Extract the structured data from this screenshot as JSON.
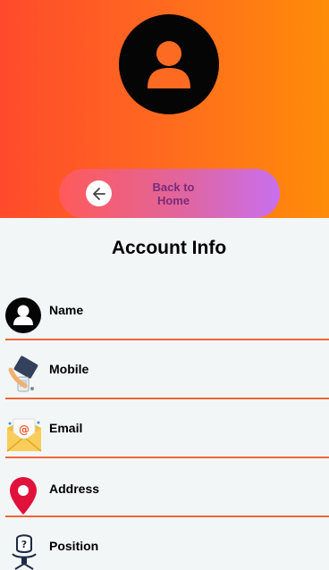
{
  "header": {
    "back_label": "Back to\nHome"
  },
  "page_title": "Account Info",
  "fields": [
    {
      "label": "Name",
      "icon": "user-icon"
    },
    {
      "label": "Mobile",
      "icon": "mobile-icon"
    },
    {
      "label": "Email",
      "icon": "email-icon"
    },
    {
      "label": "Address",
      "icon": "location-pin-icon"
    },
    {
      "label": "Position",
      "icon": "position-icon"
    }
  ],
  "colors": {
    "header_gradient": [
      "#ff4a2c",
      "#ff8c08"
    ],
    "button_gradient": [
      "#ff5a59",
      "#c86ff0"
    ],
    "divider": "#f0653a",
    "pin": "#e0123c"
  }
}
